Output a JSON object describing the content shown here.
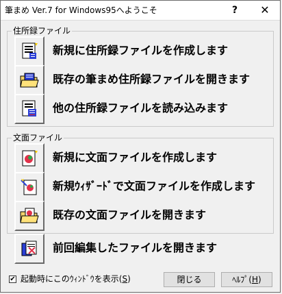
{
  "window": {
    "title": "筆まめ Ver.7 for Windows95へようこそ",
    "help_glyph": "?",
    "close_glyph": "✕"
  },
  "address_group": {
    "label": "住所録ファイル",
    "items": [
      {
        "label": "新規に住所録ファイルを作成します",
        "icon": "new-address-book-icon"
      },
      {
        "label": "既存の筆まめ住所録ファイルを開きます",
        "icon": "open-folder-icon"
      },
      {
        "label": "他の住所録ファイルを読み込みます",
        "icon": "import-address-book-icon"
      }
    ]
  },
  "document_group": {
    "label": "文面ファイル",
    "items": [
      {
        "label": "新規に文面ファイルを作成します",
        "icon": "new-document-icon"
      },
      {
        "label": "新規ｳｨｻﾞｰﾄﾞで文面ファイルを作成します",
        "icon": "wizard-icon"
      },
      {
        "label": "既存の文面ファイルを開きます",
        "icon": "open-document-folder-icon"
      }
    ]
  },
  "recent": {
    "label": "前回編集したファイルを開きます",
    "icon": "recent-files-icon"
  },
  "footer": {
    "checkbox_checked": true,
    "checkbox_mark": "✔",
    "checkbox_label_prefix": "起動時にこのｳｨﾝﾄﾞｳを表示(",
    "checkbox_label_key": "S",
    "checkbox_label_suffix": ")",
    "close_button_label": "閉じる",
    "help_button_prefix": "ﾍﾙﾌﾟ(",
    "help_button_key": "H",
    "help_button_suffix": ")"
  }
}
